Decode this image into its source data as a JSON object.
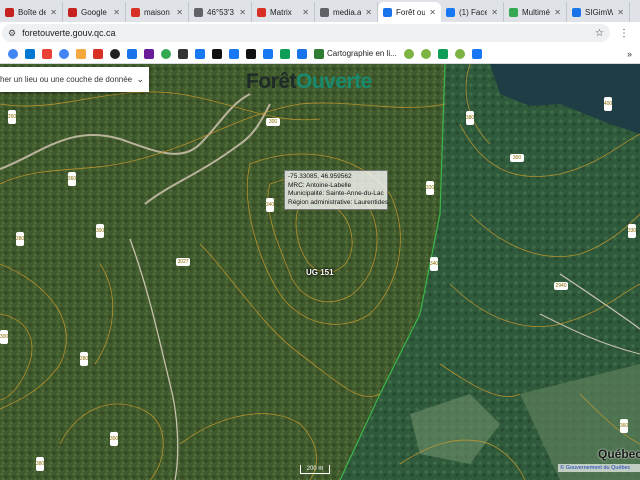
{
  "tabs": [
    {
      "title": "Boîte de",
      "color": "#c5221f"
    },
    {
      "title": "Google I",
      "color": "#c5221f"
    },
    {
      "title": "maison",
      "color": "#d93025"
    },
    {
      "title": "46°53'3",
      "color": "#5f6368"
    },
    {
      "title": "Matrix",
      "color": "#d93025"
    },
    {
      "title": "media.a",
      "color": "#5f6368"
    },
    {
      "title": "Forêt ou",
      "color": "#1a73e8",
      "active": true
    },
    {
      "title": "(1) Face",
      "color": "#1877f2"
    },
    {
      "title": "Multimé",
      "color": "#34a853"
    },
    {
      "title": "SIGimW",
      "color": "#1a73e8"
    }
  ],
  "address_bar": {
    "url": "foretouverte.gouv.qc.ca"
  },
  "bookmarks": {
    "named_item": "Cartographie en li..."
  },
  "map": {
    "search_placeholder": "cher un lieu ou une couche de données",
    "brand_part1": "Forêt",
    "brand_part2": "Ouverte",
    "info_popup": {
      "coordinates": "-75.33085, 46.959562",
      "mrc": "MRC: Antoine-Labelle",
      "municipality": "Municipalité: Sainte-Anne-du-Lac",
      "region": "Région administrative: Laurentides"
    },
    "ug_label": "UG 151",
    "scale_label": "200 m",
    "quebec_logo": "Québec",
    "attribution": "© Gouvernement du Québec",
    "contour_labels": [
      "260",
      "300",
      "380",
      "400",
      "360",
      "340",
      "320",
      "300",
      "280",
      "300",
      "340",
      "330",
      "3027",
      "2940",
      "300",
      "280",
      "300",
      "380",
      "360"
    ]
  }
}
